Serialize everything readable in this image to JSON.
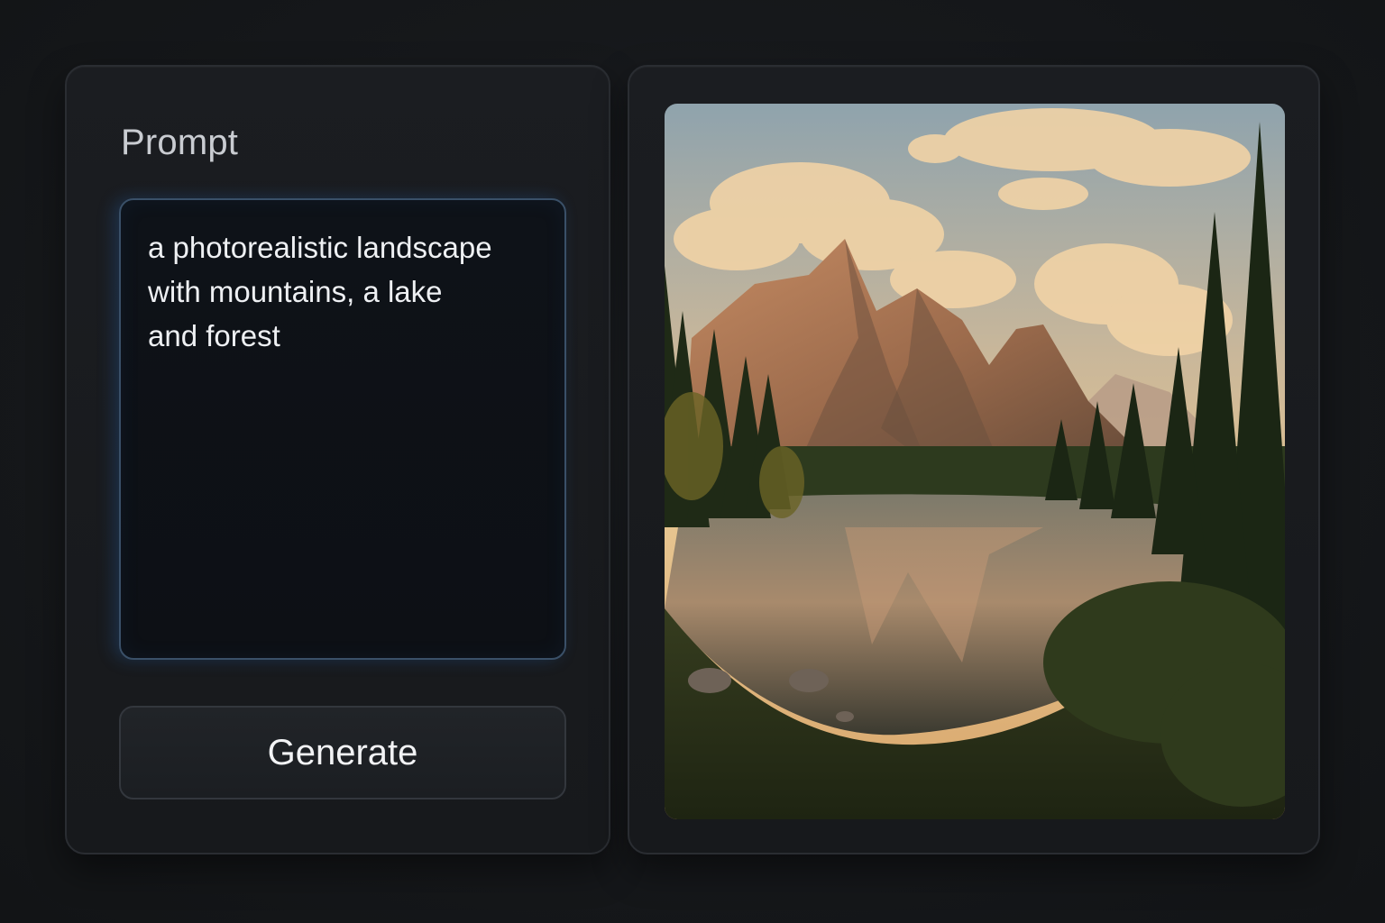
{
  "prompt_panel": {
    "label": "Prompt",
    "prompt_text": "a photorealistic landscape\nwith mountains, a lake\nand forest",
    "generate_label": "Generate"
  },
  "output_panel": {
    "image_subject": "mountain-lake-forest-landscape"
  },
  "colors": {
    "background": "#16181b",
    "panel": "#1b1d21",
    "prompt_focus_border": "#3a5068"
  }
}
